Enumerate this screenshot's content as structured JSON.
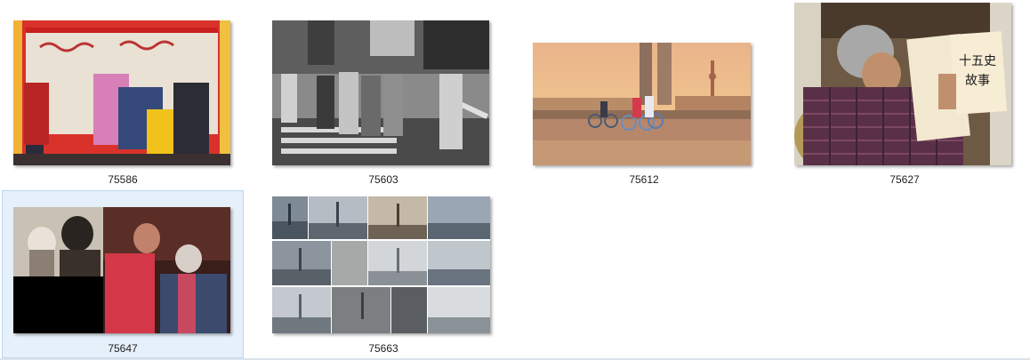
{
  "files": [
    {
      "name": "75586",
      "subject": "colorful-street-scene-with-red-sign-board-thumbnail"
    },
    {
      "name": "75603",
      "subject": "black-and-white-street-crowd-thumbnail"
    },
    {
      "name": "75612",
      "subject": "sunset-cyclists-on-riverside-with-tower-thumbnail"
    },
    {
      "name": "75627",
      "subject": "elderly-woman-reading-book-thumbnail"
    },
    {
      "name": "75647",
      "subject": "old-photo-and-two-people-portrait-thumbnail"
    },
    {
      "name": "75663",
      "subject": "city-skyline-collage-thumbnail"
    }
  ],
  "selected_file": "75647",
  "colors": {
    "selection_bg": "#e6f0fa",
    "selection_border": "#b9d7f2",
    "label_text": "#1e1e1e"
  }
}
